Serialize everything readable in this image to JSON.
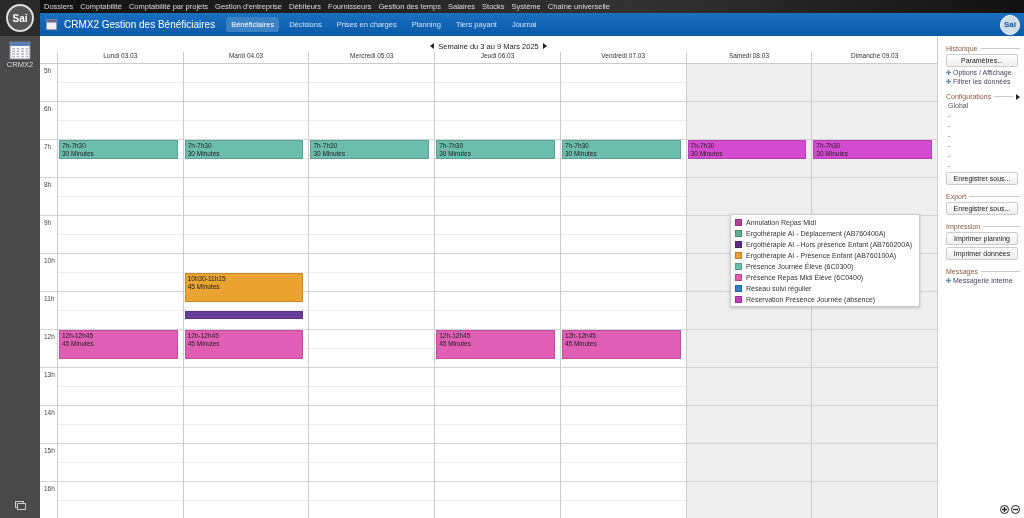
{
  "logo_text": "Sai",
  "menu": [
    "Dossiers",
    "Comptabilité",
    "Comptabilité par projets",
    "Gestion d'entreprise",
    "Débiteurs",
    "Fournisseurs",
    "Gestion des temps",
    "Salaires",
    "Stocks",
    "Système",
    "Chaîne universelle"
  ],
  "app_launcher": {
    "label": "CRMX2"
  },
  "header": {
    "title": "CRMX2 Gestion des Bénéficiaires",
    "logo_text": "Sai",
    "tabs": [
      {
        "label": "Bénéficiaires",
        "selected": true
      },
      {
        "label": "Décisions",
        "selected": false
      },
      {
        "label": "Prises en charges",
        "selected": false
      },
      {
        "label": "Planning",
        "selected": false
      },
      {
        "label": "Tiers payant",
        "selected": false
      },
      {
        "label": "Journal",
        "selected": false
      }
    ]
  },
  "week": {
    "title": "Semaine du 3 au 9 Mars 2025"
  },
  "hours": [
    "5h",
    "6h",
    "7h",
    "8h",
    "9h",
    "10h",
    "11h",
    "12h",
    "13h",
    "14h",
    "15h",
    "16h"
  ],
  "days": [
    {
      "label": "Lundi 03.03",
      "weekend": false,
      "events": [
        {
          "kind": "block",
          "time": "7h-7h30",
          "duration": "30 Minutes",
          "color": "#6dbdad"
        },
        {
          "kind": "block",
          "time": "12h-12h45",
          "duration": "45 Minutes",
          "color": "#e05fb5"
        }
      ]
    },
    {
      "label": "Mardi 04.03",
      "weekend": false,
      "events": [
        {
          "kind": "block",
          "time": "7h-7h30",
          "duration": "30 Minutes",
          "color": "#6dbdad"
        },
        {
          "kind": "block",
          "time": "10h30-11h15",
          "duration": "45 Minutes",
          "color": "#eba331"
        },
        {
          "kind": "bar",
          "color": "#6a3d9a"
        },
        {
          "kind": "block",
          "time": "12h-12h45",
          "duration": "45 Minutes",
          "color": "#e05fb5"
        }
      ]
    },
    {
      "label": "Mercredi 05.03",
      "weekend": false,
      "events": [
        {
          "kind": "block",
          "time": "7h-7h30",
          "duration": "30 Minutes",
          "color": "#6dbdad"
        }
      ]
    },
    {
      "label": "Jeudi 06.03",
      "weekend": false,
      "events": [
        {
          "kind": "block",
          "time": "7h-7h30",
          "duration": "30 Minutes",
          "color": "#6dbdad"
        },
        {
          "kind": "block",
          "time": "12h-12h45",
          "duration": "45 Minutes",
          "color": "#e05fb5"
        }
      ]
    },
    {
      "label": "Vendredi 07.03",
      "weekend": false,
      "events": [
        {
          "kind": "block",
          "time": "7h-7h30",
          "duration": "30 Minutes",
          "color": "#6dbdad"
        },
        {
          "kind": "block",
          "time": "12h-12h45",
          "duration": "45 Minutes",
          "color": "#e05fb5"
        }
      ]
    },
    {
      "label": "Samedi 08.03",
      "weekend": true,
      "events": [
        {
          "kind": "block",
          "time": "7h-7h30",
          "duration": "30 Minutes",
          "color": "#d44bd0"
        }
      ]
    },
    {
      "label": "Dimanche 09.03",
      "weekend": true,
      "events": [
        {
          "kind": "block",
          "time": "7h-7h30",
          "duration": "30 Minutes",
          "color": "#d44bd0"
        }
      ]
    }
  ],
  "legend": [
    {
      "label": "Annulation Repas Midi",
      "color": "#b0409a"
    },
    {
      "label": "Ergothérapie AI - Déplacement (AB760400A)",
      "color": "#5cae8f"
    },
    {
      "label": "Ergothérapie AI - Hors présence Enfant (AB760200A)",
      "color": "#5a2d82"
    },
    {
      "label": "Ergothérapie AI - Présence Enfant (AB760100A)",
      "color": "#e8a030"
    },
    {
      "label": "Présence Journée Élève (6C0300)",
      "color": "#6cbfae"
    },
    {
      "label": "Présence Repas Midi Élève (6C0400)",
      "color": "#e060b0"
    },
    {
      "label": "Réseau suivi régulier",
      "color": "#2f7fc8"
    },
    {
      "label": "Réservation Présence Journée (absence)",
      "color": "#c040c0"
    }
  ],
  "panel": [
    {
      "title": "Historique",
      "items": [
        {
          "kind": "button",
          "label": "Paramètres..."
        },
        {
          "kind": "link",
          "label": "Options / Affichage"
        },
        {
          "kind": "link",
          "label": "Filtrer les données"
        }
      ]
    },
    {
      "title": "Configurations",
      "arrow": true,
      "items": [
        {
          "kind": "text",
          "label": "Global"
        },
        {
          "kind": "text",
          "label": "-"
        },
        {
          "kind": "text",
          "label": "-"
        },
        {
          "kind": "text",
          "label": "-"
        },
        {
          "kind": "text",
          "label": "-"
        },
        {
          "kind": "text",
          "label": "-"
        },
        {
          "kind": "text",
          "label": "-"
        },
        {
          "kind": "button",
          "label": "Enregistrer sous..."
        }
      ]
    },
    {
      "title": "Export",
      "items": [
        {
          "kind": "button",
          "label": "Enregistrer sous..."
        }
      ]
    },
    {
      "title": "Impression",
      "items": [
        {
          "kind": "button",
          "label": "Imprimer planning"
        },
        {
          "kind": "button",
          "label": "Imprimer données"
        }
      ]
    },
    {
      "title": "Messages",
      "items": [
        {
          "kind": "link",
          "label": "Messagerie interne"
        }
      ]
    }
  ]
}
